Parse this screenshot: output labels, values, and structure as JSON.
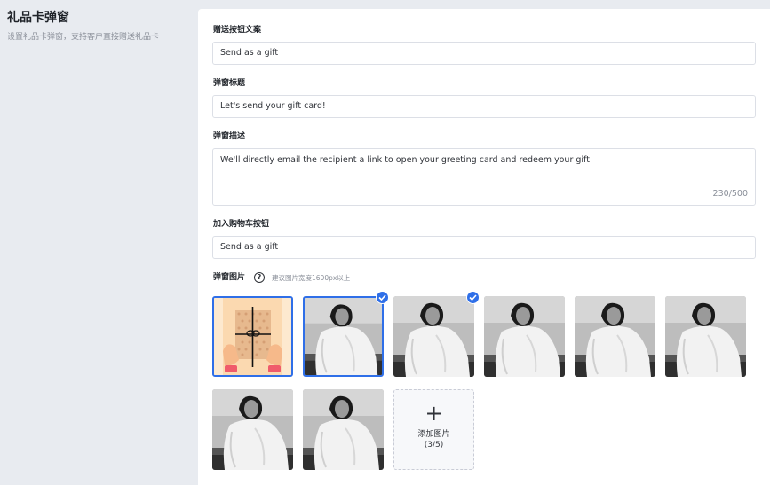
{
  "sidebar": {
    "title": "礼品卡弹窗",
    "description": "设置礼品卡弹窗，支持客户直接赠送礼品卡"
  },
  "form": {
    "send_button_label": "赠送按钮文案",
    "send_button_value": "Send as a gift",
    "popup_title_label": "弹窗标题",
    "popup_title_value": "Let's send your gift card!",
    "popup_desc_label": "弹窗描述",
    "popup_desc_value": "We'll directly email the recipient a link to open your greeting card and redeem your gift.",
    "popup_desc_counter": "230/500",
    "cart_button_label": "加入购物车按钮",
    "cart_button_value": "Send as a gift",
    "images_label": "弹窗图片",
    "images_hint": "建议图片宽度1600px以上",
    "help_icon_glyph": "?"
  },
  "images": {
    "add_plus": "+",
    "add_label": "添加图片",
    "add_count": "(3/5)",
    "items": [
      {
        "kind": "gift-illustration",
        "selected": true,
        "checked": false
      },
      {
        "kind": "photo",
        "selected": true,
        "checked": true
      },
      {
        "kind": "photo",
        "selected": false,
        "checked": true
      },
      {
        "kind": "photo",
        "selected": false,
        "checked": false
      },
      {
        "kind": "photo",
        "selected": false,
        "checked": false
      },
      {
        "kind": "photo",
        "selected": false,
        "checked": false
      },
      {
        "kind": "photo",
        "selected": false,
        "checked": false
      },
      {
        "kind": "photo",
        "selected": false,
        "checked": false
      }
    ]
  },
  "colors": {
    "accent": "#2f6fe8",
    "background": "#e8ebf0",
    "panel": "#ffffff"
  }
}
